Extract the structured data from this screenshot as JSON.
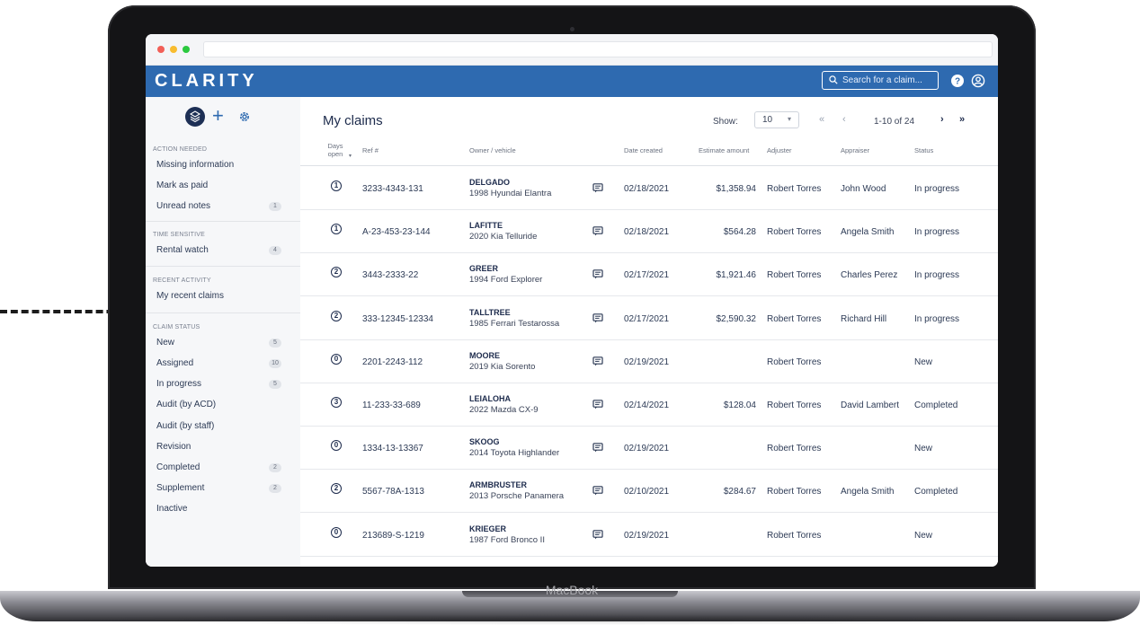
{
  "device_label": "MacBook",
  "app": {
    "logo": "CLARITY",
    "search_placeholder": "Search for a claim..."
  },
  "sidebar": {
    "sections": [
      {
        "heading": "ACTION NEEDED",
        "items": [
          {
            "label": "Missing information",
            "count": ""
          },
          {
            "label": "Mark as paid",
            "count": ""
          },
          {
            "label": "Unread notes",
            "count": "1"
          }
        ]
      },
      {
        "heading": "TIME SENSITIVE",
        "items": [
          {
            "label": "Rental watch",
            "count": "4"
          }
        ]
      },
      {
        "heading": "RECENT ACTIVITY",
        "items": [
          {
            "label": "My recent claims",
            "count": ""
          }
        ]
      },
      {
        "heading": "CLAIM STATUS",
        "items": [
          {
            "label": "New",
            "count": "5"
          },
          {
            "label": "Assigned",
            "count": "10"
          },
          {
            "label": "In progress",
            "count": "5"
          },
          {
            "label": "Audit (by ACD)",
            "count": ""
          },
          {
            "label": "Audit (by staff)",
            "count": ""
          },
          {
            "label": "Revision",
            "count": ""
          },
          {
            "label": "Completed",
            "count": "2"
          },
          {
            "label": "Supplement",
            "count": "2"
          },
          {
            "label": "Inactive",
            "count": ""
          }
        ]
      }
    ]
  },
  "main": {
    "title": "My claims",
    "show_label": "Show:",
    "page_size": "10",
    "pagination_text": "1-10 of 24",
    "columns": {
      "days_open": "Days open",
      "ref": "Ref #",
      "owner_vehicle": "Owner / vehicle",
      "date_created": "Date created",
      "estimate": "Estimate amount",
      "adjuster": "Adjuster",
      "appraiser": "Appraiser",
      "status": "Status"
    },
    "rows": [
      {
        "days": "1",
        "ref": "3233-4343-131",
        "owner": "DELGADO",
        "vehicle": "1998 Hyundai Elantra",
        "date": "02/18/2021",
        "estimate": "$1,358.94",
        "adjuster": "Robert Torres",
        "appraiser": "John Wood",
        "status": "In progress"
      },
      {
        "days": "1",
        "ref": "A-23-453-23-144",
        "owner": "LAFITTE",
        "vehicle": "2020 Kia Telluride",
        "date": "02/18/2021",
        "estimate": "$564.28",
        "adjuster": "Robert Torres",
        "appraiser": "Angela Smith",
        "status": "In progress"
      },
      {
        "days": "2",
        "ref": "3443-2333-22",
        "owner": "GREER",
        "vehicle": "1994 Ford Explorer",
        "date": "02/17/2021",
        "estimate": "$1,921.46",
        "adjuster": "Robert Torres",
        "appraiser": "Charles Perez",
        "status": "In progress"
      },
      {
        "days": "2",
        "ref": "333-12345-12334",
        "owner": "TALLTREE",
        "vehicle": "1985 Ferrari Testarossa",
        "date": "02/17/2021",
        "estimate": "$2,590.32",
        "adjuster": "Robert Torres",
        "appraiser": "Richard Hill",
        "status": "In progress"
      },
      {
        "days": "0",
        "ref": "2201-2243-112",
        "owner": "MOORE",
        "vehicle": "2019 Kia Sorento",
        "date": "02/19/2021",
        "estimate": "",
        "adjuster": "Robert Torres",
        "appraiser": "",
        "status": "New"
      },
      {
        "days": "3",
        "ref": "11-233-33-689",
        "owner": "LEIALOHA",
        "vehicle": "2022 Mazda CX-9",
        "date": "02/14/2021",
        "estimate": "$128.04",
        "adjuster": "Robert Torres",
        "appraiser": "David Lambert",
        "status": "Completed"
      },
      {
        "days": "0",
        "ref": "1334-13-13367",
        "owner": "SKOOG",
        "vehicle": "2014 Toyota Highlander",
        "date": "02/19/2021",
        "estimate": "",
        "adjuster": "Robert Torres",
        "appraiser": "",
        "status": "New"
      },
      {
        "days": "2",
        "ref": "5567-78A-1313",
        "owner": "ARMBRUSTER",
        "vehicle": "2013 Porsche Panamera",
        "date": "02/10/2021",
        "estimate": "$284.67",
        "adjuster": "Robert Torres",
        "appraiser": "Angela Smith",
        "status": "Completed"
      },
      {
        "days": "0",
        "ref": "213689-S-1219",
        "owner": "KRIEGER",
        "vehicle": "1987 Ford Bronco II",
        "date": "02/19/2021",
        "estimate": "",
        "adjuster": "Robert Torres",
        "appraiser": "",
        "status": "New"
      }
    ]
  },
  "icons": {
    "search": "search-icon",
    "help": "help-icon",
    "user": "user-icon",
    "layers": "layers-icon",
    "add": "plus-icon",
    "settings": "gear-icon",
    "note": "note-icon"
  },
  "colors": {
    "brand": "#2e6ab0",
    "navy": "#1d2b4c",
    "sidebar_bg": "#f6f7f9"
  }
}
